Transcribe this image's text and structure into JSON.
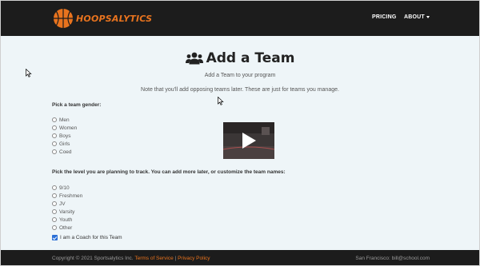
{
  "brand": {
    "name": "HOOPSALYTICS",
    "accent_color": "#e8731e",
    "logo_icon": "basketball-icon"
  },
  "nav": {
    "pricing": "PRICING",
    "about": "ABOUT"
  },
  "page": {
    "title": "Add a Team",
    "title_icon": "users-icon",
    "subtitle": "Add a Team to your program",
    "note": "Note that you'll add opposing teams later. These are just for teams you manage."
  },
  "gender": {
    "label": "Pick a team gender:",
    "options": [
      "Men",
      "Women",
      "Boys",
      "Girls",
      "Coed"
    ]
  },
  "level": {
    "label": "Pick the level you are planning to track. You can add more later, or customize the team names:",
    "options": [
      "9/10",
      "Freshmen",
      "JV",
      "Varsity",
      "Youth",
      "Other"
    ]
  },
  "coach": {
    "label": "I am a Coach for this Team",
    "checked": true
  },
  "video": {
    "icon": "play-icon"
  },
  "footer": {
    "copyright": "Copyright © 2021 Sportsalytics Inc.",
    "terms": "Terms of Service",
    "separator": "|",
    "privacy": "Privacy Policy",
    "contact": "San Francisco: bill@school.com"
  }
}
